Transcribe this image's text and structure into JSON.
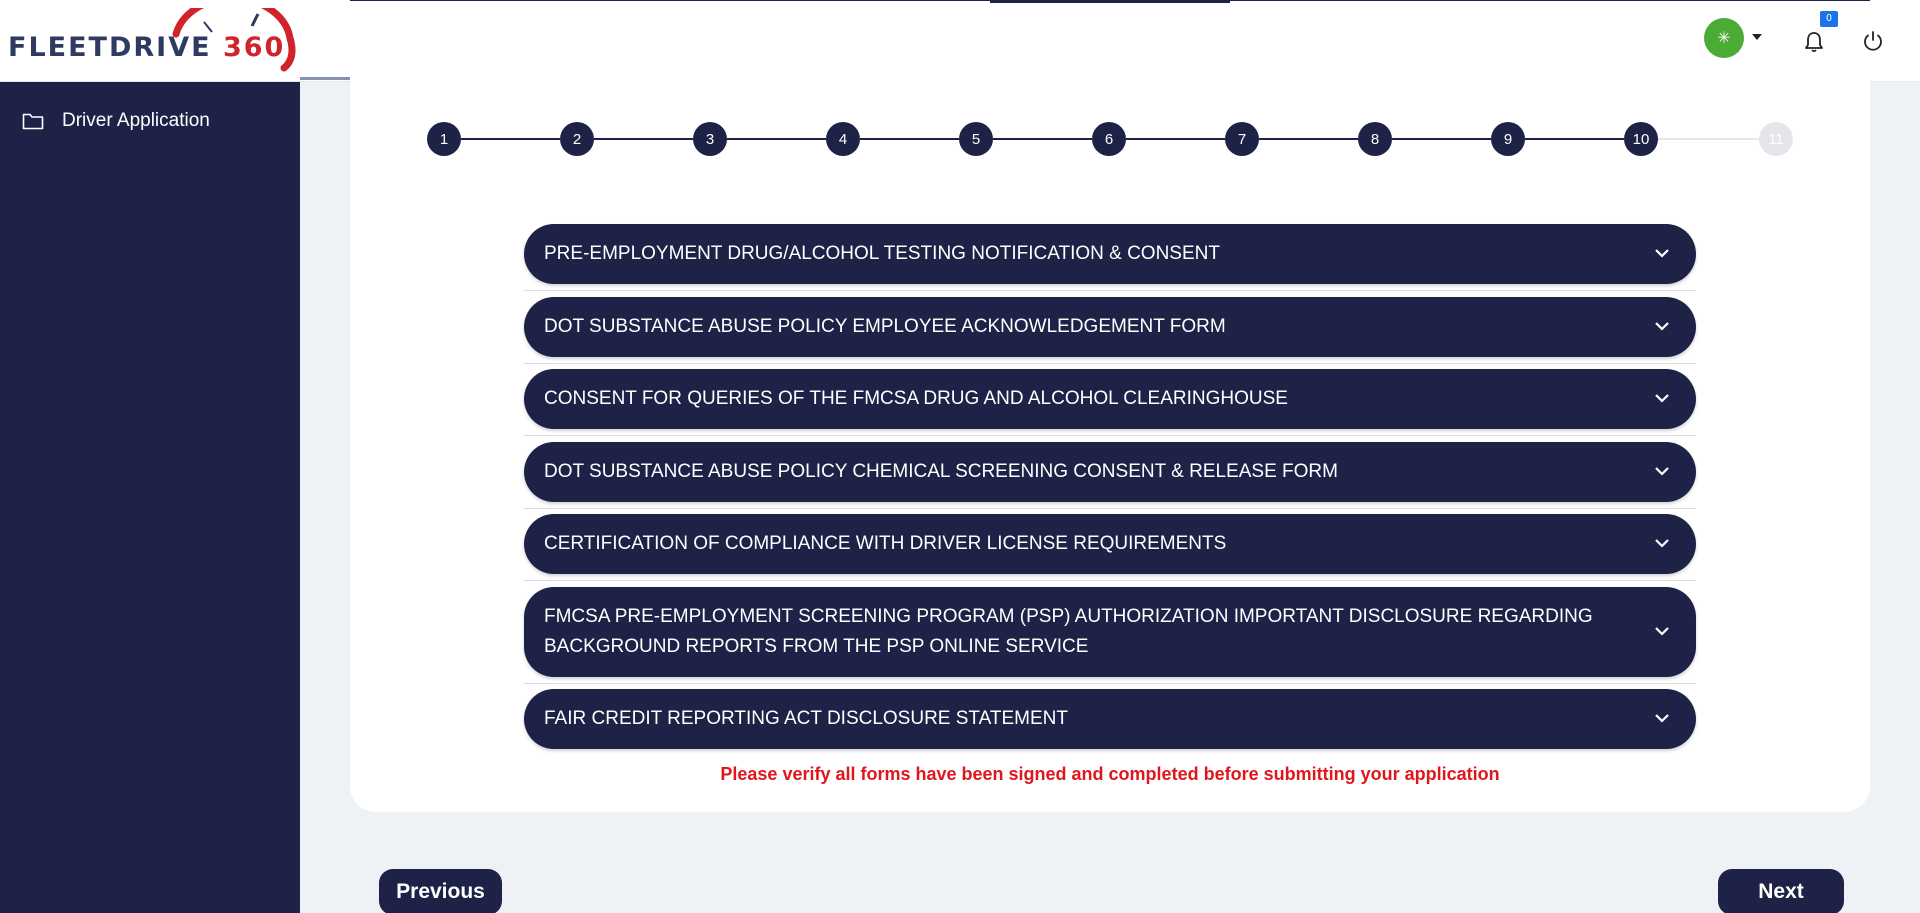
{
  "brand": {
    "logo_text": "FLEETDRIVE",
    "logo_number": "360"
  },
  "header": {
    "avatar_glyph": "✳",
    "notification_count": "0",
    "icons": [
      "bell-icon",
      "power-icon",
      "chevron-down-icon"
    ]
  },
  "sidebar": {
    "items": [
      {
        "label": "Driver Application",
        "icon": "folder-icon"
      }
    ]
  },
  "stepper": {
    "steps": [
      "1",
      "2",
      "3",
      "4",
      "5",
      "6",
      "7",
      "8",
      "9",
      "10",
      "11"
    ],
    "current": "10",
    "completed_through": 10
  },
  "forms": [
    {
      "title": "PRE-EMPLOYMENT DRUG/ALCOHOL TESTING NOTIFICATION & CONSENT"
    },
    {
      "title": "DOT SUBSTANCE ABUSE POLICY EMPLOYEE ACKNOWLEDGEMENT FORM"
    },
    {
      "title": "CONSENT FOR QUERIES OF THE FMCSA DRUG AND ALCOHOL CLEARINGHOUSE"
    },
    {
      "title": "DOT SUBSTANCE ABUSE POLICY CHEMICAL SCREENING CONSENT & RELEASE FORM"
    },
    {
      "title": "CERTIFICATION OF COMPLIANCE WITH DRIVER LICENSE REQUIREMENTS"
    },
    {
      "title": "FMCSA PRE-EMPLOYMENT SCREENING PROGRAM (PSP) AUTHORIZATION IMPORTANT DISCLOSURE REGARDING BACKGROUND REPORTS FROM THE PSP ONLINE SERVICE"
    },
    {
      "title": "FAIR CREDIT REPORTING ACT DISCLOSURE STATEMENT"
    }
  ],
  "warning": "Please verify all forms have been signed and completed before submitting your application",
  "nav": {
    "previous_label": "Previous",
    "next_label": "Next"
  },
  "colors": {
    "navy": "#1e2247",
    "alert_red": "#e0161d",
    "avatar_green": "#4aab35",
    "badge_blue": "#1a73e8",
    "logo_red": "#d0232b"
  }
}
